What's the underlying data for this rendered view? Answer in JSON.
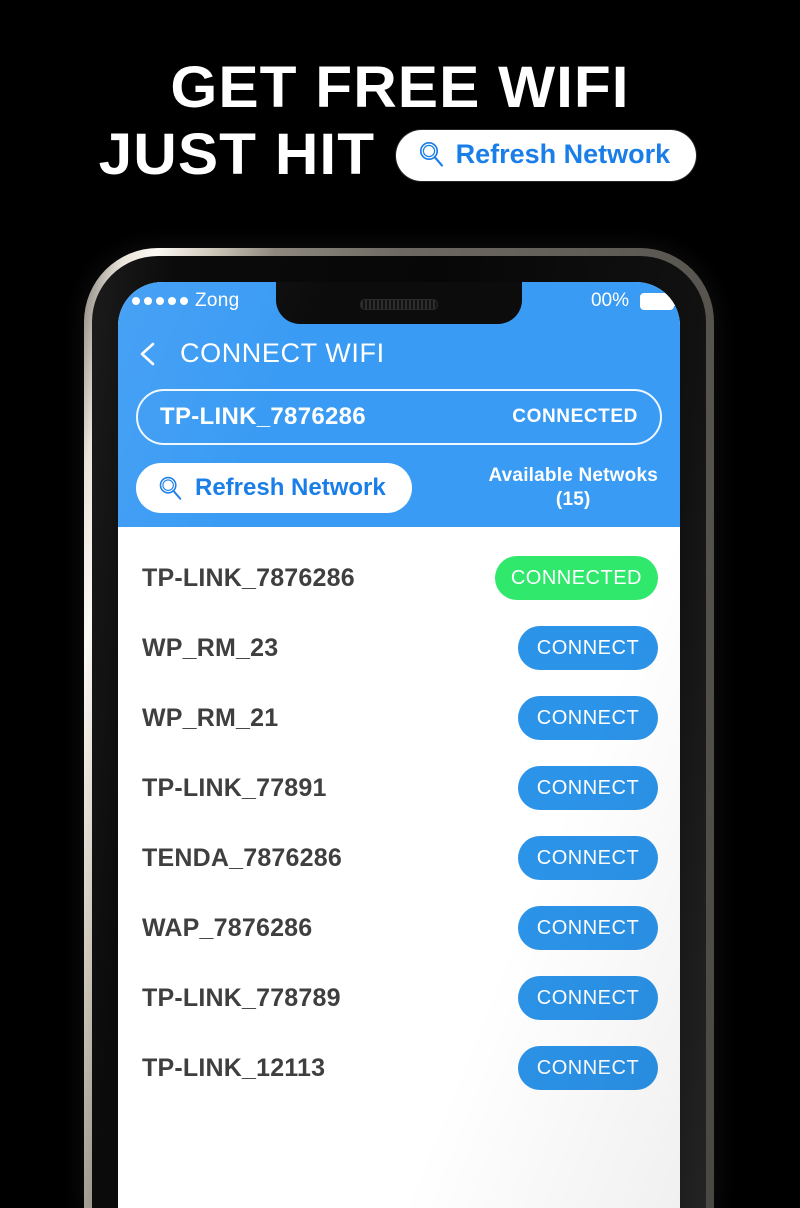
{
  "promo": {
    "line1": "GET FREE WIFI",
    "line2": "JUST HIT",
    "pill_label": "Refresh Network",
    "pill_icon": "magnifier-icon",
    "text_color": "#ffffff",
    "pill_bg": "#ffffff",
    "pill_text_color": "#1a7ee8",
    "background": "#000000"
  },
  "phone": {
    "status_bar": {
      "carrier": "Zong",
      "signal_dots": 5,
      "battery_percent": "00%",
      "battery_icon": "battery-full-icon"
    },
    "header": {
      "back_icon": "chevron-left-icon",
      "title": "CONNECT WIFI",
      "background": "#3a9bf4",
      "connected_bar": {
        "ssid": "TP-LINK_7876286",
        "state": "CONNECTED"
      },
      "refresh_button": {
        "label": "Refresh Network",
        "icon": "magnifier-icon"
      },
      "available": {
        "title": "Available Netwoks",
        "count": "(15)"
      }
    },
    "networks": [
      {
        "ssid": "TP-LINK_7876286",
        "action": "CONNECTED",
        "state": "connected"
      },
      {
        "ssid": "WP_RM_23",
        "action": "CONNECT",
        "state": "connect"
      },
      {
        "ssid": "WP_RM_21",
        "action": "CONNECT",
        "state": "connect"
      },
      {
        "ssid": "TP-LINK_77891",
        "action": "CONNECT",
        "state": "connect"
      },
      {
        "ssid": "TENDA_7876286",
        "action": "CONNECT",
        "state": "connect"
      },
      {
        "ssid": "WAP_7876286",
        "action": "CONNECT",
        "state": "connect"
      },
      {
        "ssid": "TP-LINK_778789",
        "action": "CONNECT",
        "state": "connect"
      },
      {
        "ssid": "TP-LINK_12113",
        "action": "CONNECT",
        "state": "connect"
      }
    ],
    "colors": {
      "header_blue": "#3a9bf4",
      "connect_blue": "#2b93e8",
      "connected_green": "#2fe86c",
      "list_bg": "#ffffff",
      "ssid_text": "#3f3f3f"
    }
  }
}
